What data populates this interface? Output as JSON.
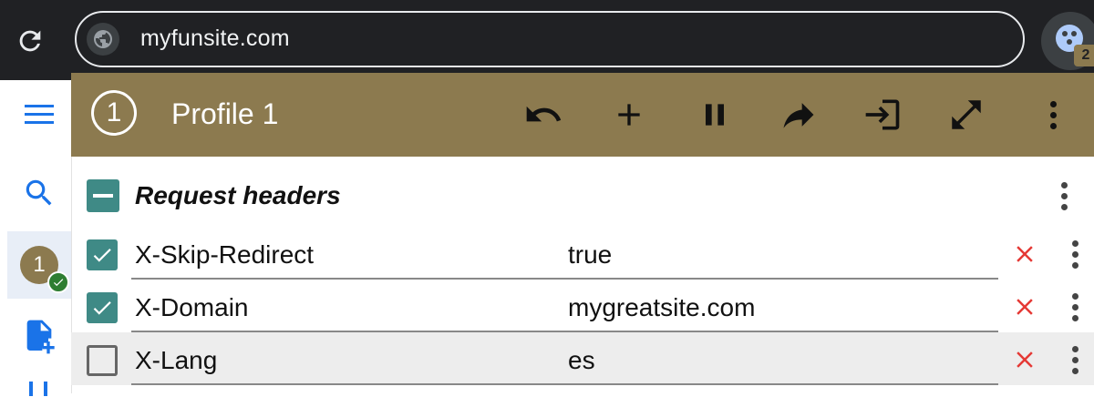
{
  "browser": {
    "url": "myfunsite.com",
    "extension_badge": "2"
  },
  "sidebar": {
    "items": [
      {
        "name": "menu-icon"
      },
      {
        "name": "search-icon"
      },
      {
        "name": "profile-avatar",
        "label": "1"
      },
      {
        "name": "add-file-icon"
      }
    ]
  },
  "profile": {
    "number": "1",
    "name": "Profile 1",
    "header_color": "#8c7a4f"
  },
  "toolbar": {
    "icons": [
      "undo-icon",
      "add-icon",
      "pause-icon",
      "redo-icon",
      "login-icon",
      "expand-icon",
      "more-vert-icon"
    ]
  },
  "section": {
    "title": "Request headers"
  },
  "headers": [
    {
      "enabled": true,
      "name": "X-Skip-Redirect",
      "value": "true"
    },
    {
      "enabled": true,
      "name": "X-Domain",
      "value": "mygreatsite.com"
    },
    {
      "enabled": false,
      "name": "X-Lang",
      "value": "es"
    }
  ],
  "colors": {
    "accent": "#3f8a86",
    "delete": "#e53935",
    "link_blue": "#1a73e8"
  }
}
